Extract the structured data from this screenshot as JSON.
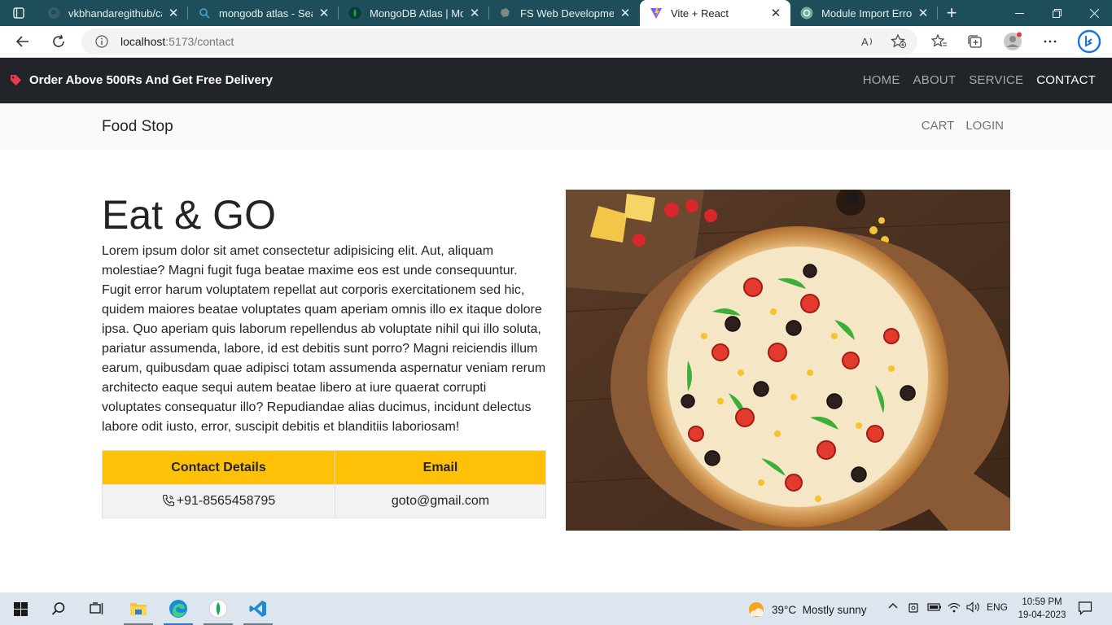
{
  "browser": {
    "tabs": [
      {
        "title": "vkbhandaregithub/cap",
        "icon": "github-icon"
      },
      {
        "title": "mongodb atlas - Searc",
        "icon": "search-icon"
      },
      {
        "title": "MongoDB Atlas | Mon",
        "icon": "mongodb-leaf-icon"
      },
      {
        "title": "FS Web Development",
        "icon": "page-icon"
      },
      {
        "title": "Vite + React",
        "icon": "vite-icon",
        "active": true
      },
      {
        "title": "Module Import Error.",
        "icon": "chatgpt-icon"
      }
    ],
    "new_tab_label": "+",
    "address": {
      "host": "localhost",
      "rest": ":5173/contact"
    }
  },
  "topbar": {
    "promo": "Order Above 500Rs And Get Free Delivery",
    "nav": [
      "HOME",
      "ABOUT",
      "SERVICE",
      "CONTACT"
    ],
    "active": "CONTACT"
  },
  "navbar": {
    "brand": "Food Stop",
    "links": [
      "CART",
      "LOGIN"
    ]
  },
  "hero": {
    "title": "Eat & GO",
    "body": "Lorem ipsum dolor sit amet consectetur adipisicing elit. Aut, aliquam molestiae? Magni fugit fuga beatae maxime eos est unde consequuntur. Fugit error harum voluptatem repellat aut corporis exercitationem sed hic, quidem maiores beatae voluptates quam aperiam omnis illo ex itaque dolore ipsa. Quo aperiam quis laborum repellendus ab voluptate nihil qui illo soluta, pariatur assumenda, labore, id est debitis sunt porro? Magni reiciendis illum earum, quibusdam quae adipisci totam assumenda aspernatur veniam rerum architecto eaque sequi autem beatae libero at iure quaerat corrupti voluptates consequatur illo? Repudiandae alias ducimus, incidunt delectus labore odit iusto, error, suscipit debitis et blanditiis laboriosam!"
  },
  "contact": {
    "headers": [
      "Contact Details",
      "Email"
    ],
    "phone": "+91-8565458795",
    "email": "goto@gmail.com"
  },
  "taskbar": {
    "weather": {
      "temp": "39°C",
      "condition": "Mostly sunny"
    },
    "language": "ENG",
    "time": "10:59 PM",
    "date": "19-04-2023"
  },
  "colors": {
    "tabstrip": "#1d4e59",
    "topbar": "#212529",
    "navbar": "#f8f9fa",
    "table_header": "#ffc107",
    "taskbar": "#dde5ee"
  }
}
